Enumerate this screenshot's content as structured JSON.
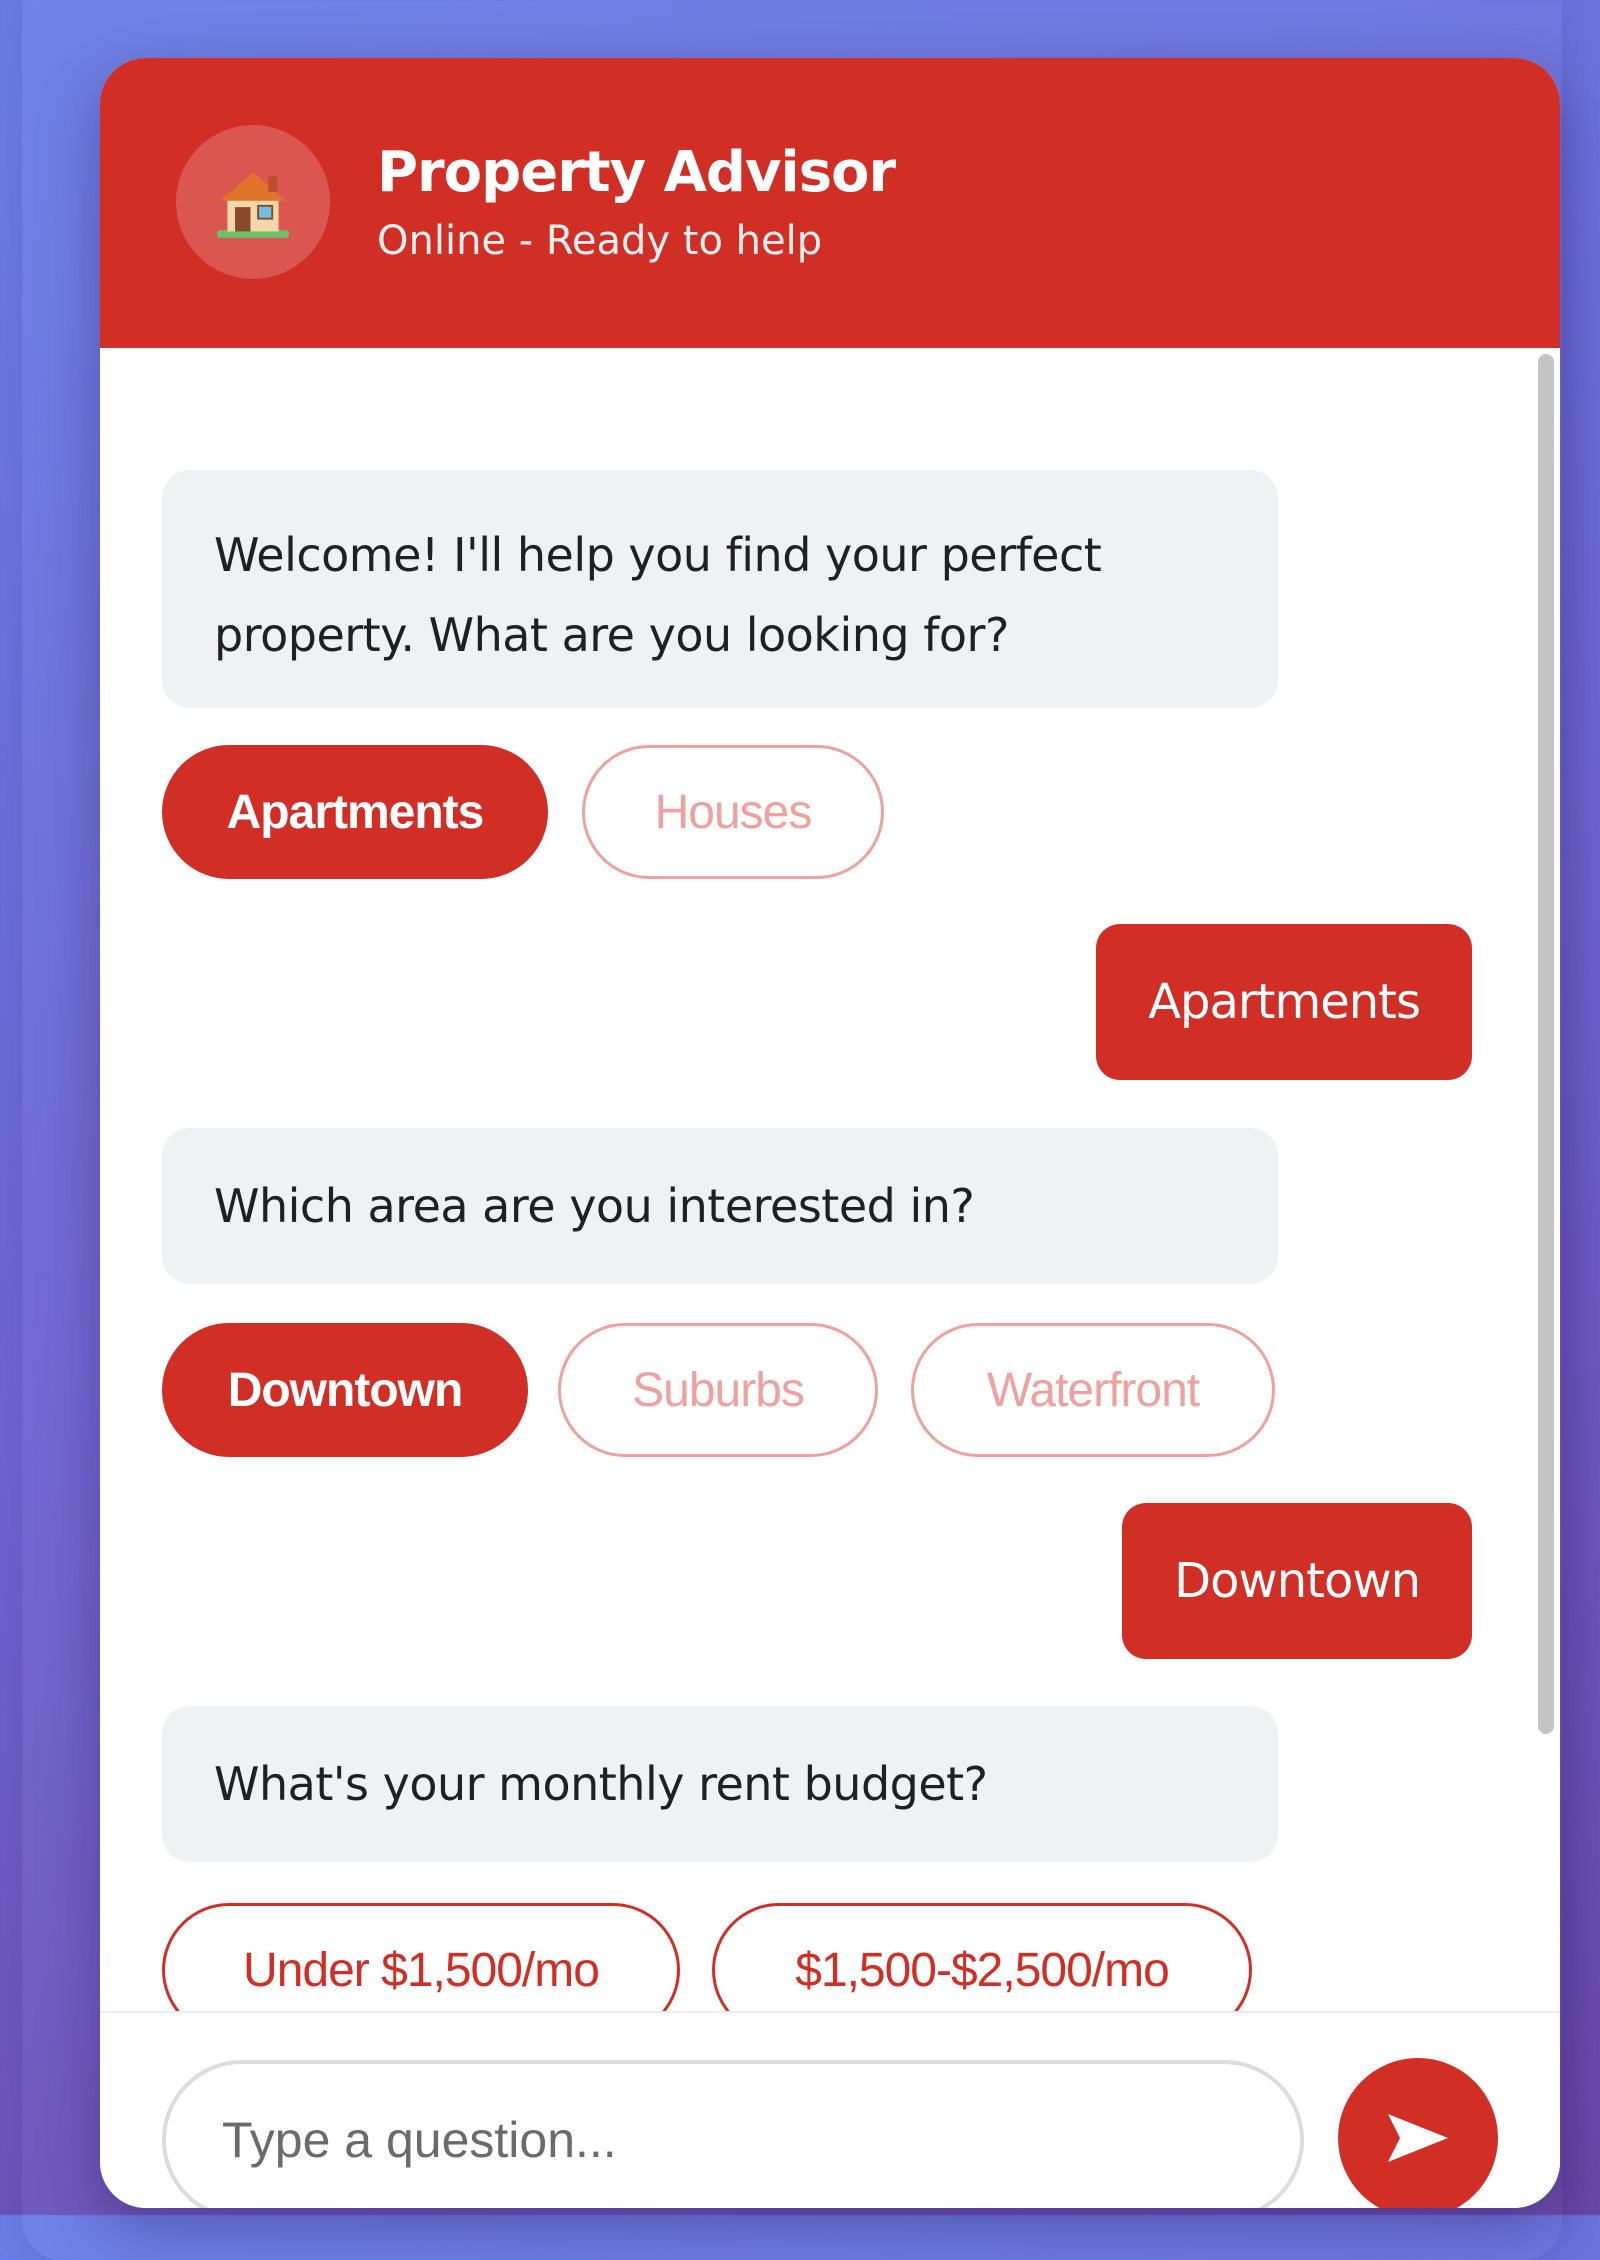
{
  "header": {
    "avatar_icon": "house-icon",
    "title": "Property Advisor",
    "status": "Online - Ready to help"
  },
  "messages": {
    "bot_1": "Welcome! I'll help you find your perfect property. What are you looking for?",
    "options_1": [
      "Apartments",
      "Houses"
    ],
    "user_1": "Apartments",
    "bot_2": "Which area are you interested in?",
    "options_2": [
      "Downtown",
      "Suburbs",
      "Waterfront"
    ],
    "user_2": "Downtown",
    "bot_3": "What's your monthly rent budget?",
    "options_3": [
      "Under $1,500/mo",
      "$1,500-$2,500/mo"
    ]
  },
  "input": {
    "placeholder": "Type a question...",
    "send_icon": "send-arrow-icon"
  },
  "colors": {
    "accent": "#d12e26",
    "bot_bubble": "#f0f1f4",
    "faded_chip": "#efa19d"
  }
}
